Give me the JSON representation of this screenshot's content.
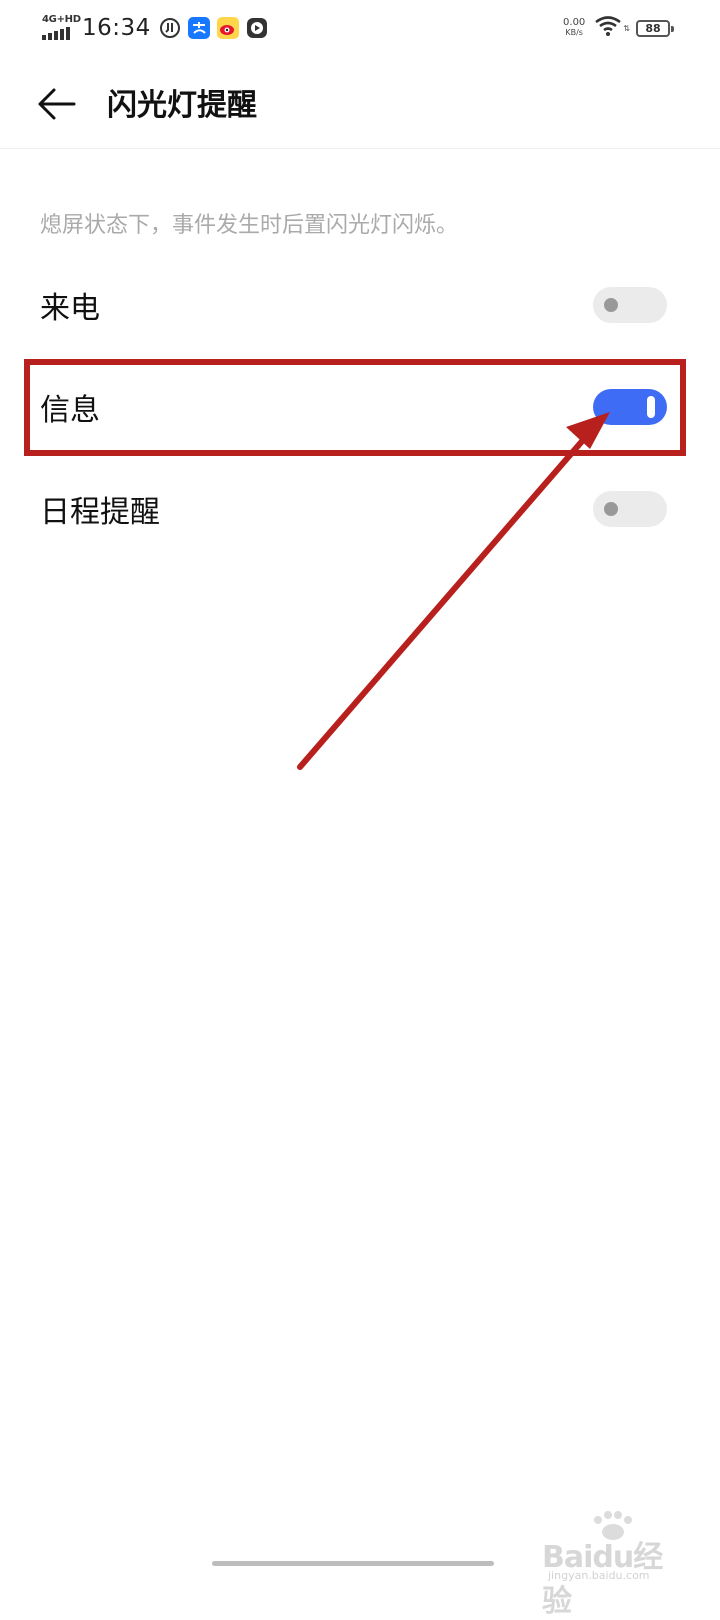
{
  "status_bar": {
    "network": "4G+HD",
    "time": "16:34",
    "speed_value": "0.00",
    "speed_unit": "KB/s",
    "battery": "88",
    "app_icons": [
      "clock-app-icon",
      "alipay-icon",
      "weibo-icon",
      "video-app-icon"
    ]
  },
  "header": {
    "title": "闪光灯提醒"
  },
  "description": "熄屏状态下，事件发生时后置闪光灯闪烁。",
  "settings": [
    {
      "label": "来电",
      "enabled": false
    },
    {
      "label": "信息",
      "enabled": true
    },
    {
      "label": "日程提醒",
      "enabled": false
    }
  ],
  "colors": {
    "toggle_on": "#3f6cf5",
    "toggle_off": "#ebebeb",
    "annotation": "#b8201e"
  },
  "watermark": {
    "brand": "Baidu经验",
    "site": "jingyan.baidu.com"
  }
}
